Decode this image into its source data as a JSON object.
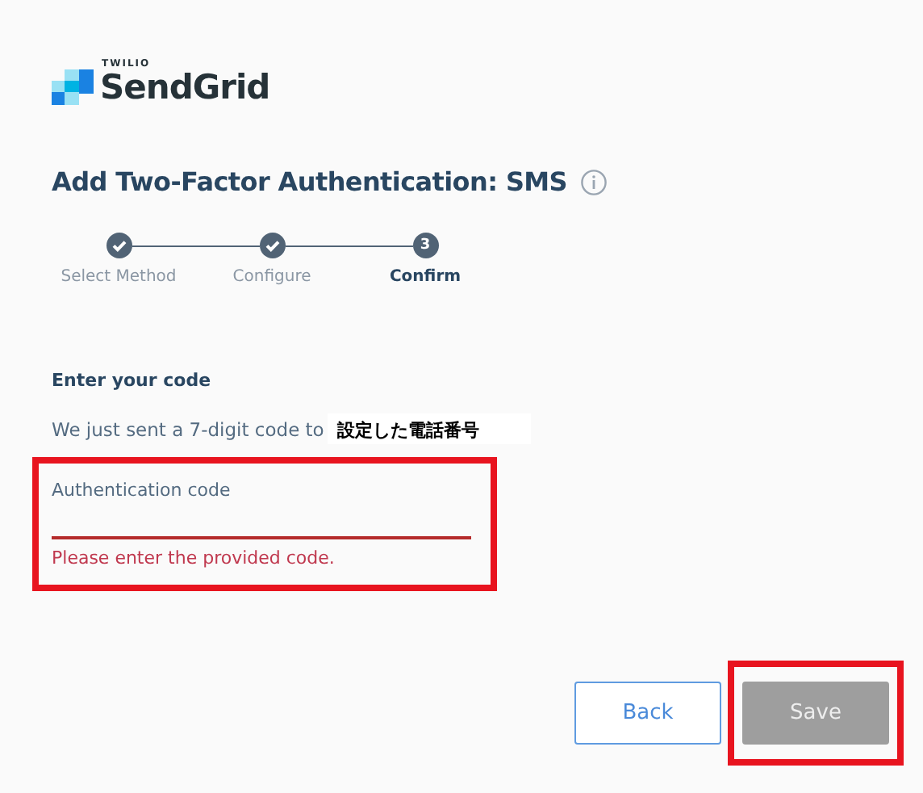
{
  "logo": {
    "small": "TWILIO",
    "name": "SendGrid"
  },
  "title": "Add Two-Factor Authentication: SMS",
  "steps": [
    {
      "label": "Select Method",
      "completed": true,
      "active": false
    },
    {
      "label": "Configure",
      "completed": true,
      "active": false
    },
    {
      "label": "Confirm",
      "completed": false,
      "active": true,
      "number": "3"
    }
  ],
  "section_heading": "Enter your code",
  "sent_text": "We just sent a 7-digit code to",
  "phone_note": "設定した電話番号",
  "code_field": {
    "label": "Authentication code",
    "error": "Please enter the provided code.",
    "highlighted": true
  },
  "buttons": [
    {
      "label": "Back",
      "kind": "secondary",
      "highlighted": false
    },
    {
      "label": "Save",
      "kind": "disabled",
      "highlighted": true
    }
  ]
}
